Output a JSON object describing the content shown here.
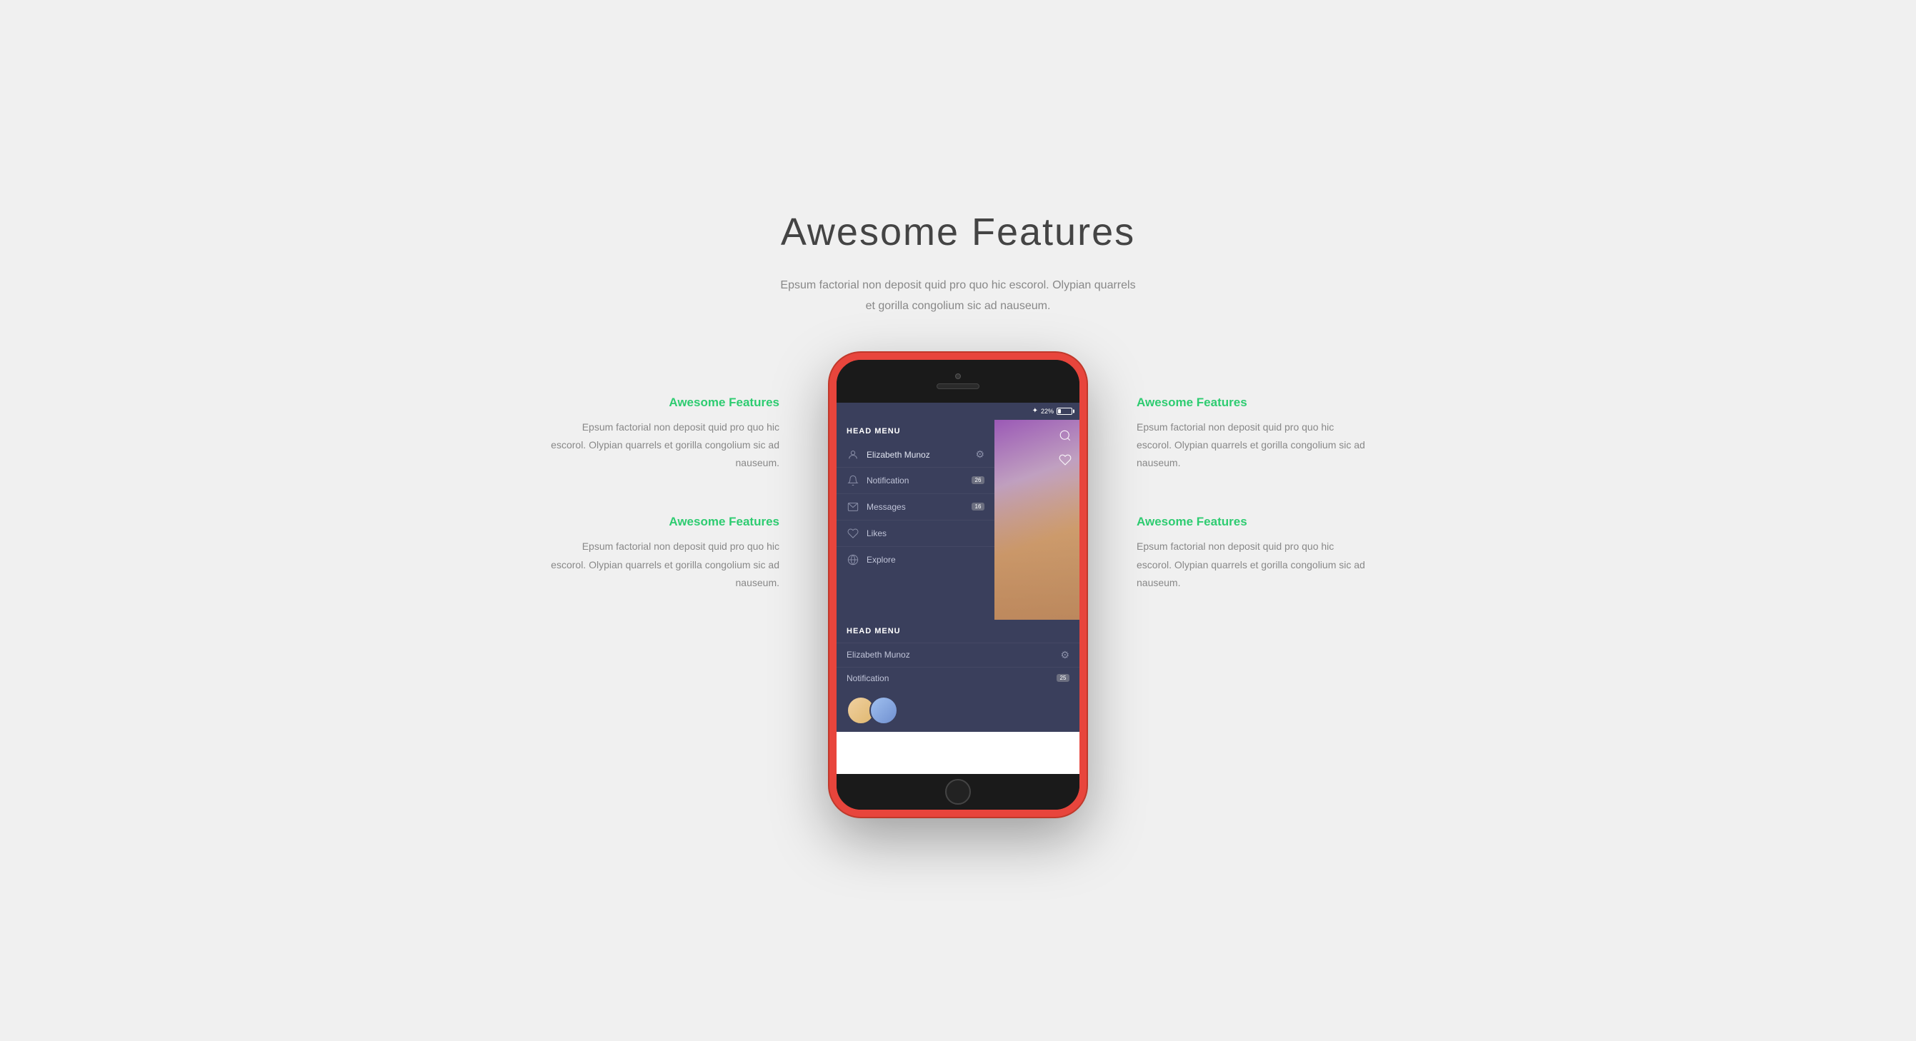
{
  "page": {
    "bg_color": "#f0f0f0"
  },
  "header": {
    "title": "Awesome Features",
    "subtitle_line1": "Epsum factorial non deposit quid pro quo hic escorol. Olypian quarrels",
    "subtitle_line2": "et gorilla congolium sic ad nauseum."
  },
  "left_features": [
    {
      "title": "Awesome Features",
      "text": "Epsum factorial non deposit quid pro quo hic escorol. Olypian quarrels et gorilla congolium sic ad nauseum."
    },
    {
      "title": "Awesome Features",
      "text": "Epsum factorial non deposit quid pro quo hic escorol. Olypian quarrels et gorilla congolium sic ad nauseum."
    }
  ],
  "right_features": [
    {
      "title": "Awesome Features",
      "text": "Epsum factorial non deposit quid pro quo hic escorol. Olypian quarrels et gorilla congolium sic ad nauseum."
    },
    {
      "title": "Awesome Features",
      "text": "Epsum factorial non deposit quid pro quo hic escorol. Olypian quarrels et gorilla congolium sic ad nauseum."
    }
  ],
  "phone": {
    "status": {
      "battery_percent": "22%",
      "bluetooth": "✦"
    },
    "menu1": {
      "header": "HEAD MENU",
      "user_name": "Elizabeth Munoz",
      "items": [
        {
          "label": "Notification",
          "badge": "26",
          "icon": "bell"
        },
        {
          "label": "Messages",
          "badge": "16",
          "icon": "mail"
        },
        {
          "label": "Likes",
          "badge": "",
          "icon": "heart"
        },
        {
          "label": "Explore",
          "badge": "",
          "icon": "globe"
        }
      ]
    },
    "menu2": {
      "header": "HEAD MENU",
      "user_name": "Elizabeth Munoz",
      "items": [
        {
          "label": "Notification",
          "badge": "25",
          "icon": "bell"
        }
      ]
    }
  },
  "accent_color": "#2ecc71",
  "menu_bg": "#3a3f5c",
  "phone_color": "#e8453c"
}
